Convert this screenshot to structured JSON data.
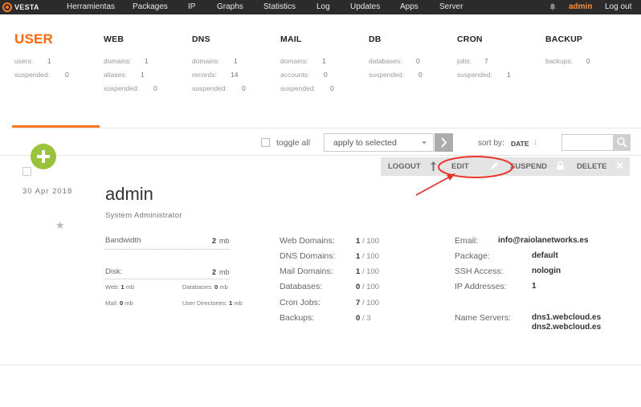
{
  "brand": {
    "logo_text": "VESTA"
  },
  "nav": {
    "items": [
      "Herramientas",
      "Packages",
      "IP",
      "Graphs",
      "Statistics",
      "Log",
      "Updates",
      "Apps",
      "Server"
    ],
    "user": "admin",
    "logout": "Log out"
  },
  "stats": {
    "user": {
      "title": "USER",
      "rows": [
        {
          "label": "users:",
          "value": "1"
        },
        {
          "label": "suspended:",
          "value": "0"
        }
      ]
    },
    "web": {
      "title": "WEB",
      "rows": [
        {
          "label": "domains:",
          "value": "1"
        },
        {
          "label": "aliases:",
          "value": "1"
        },
        {
          "label": "suspended:",
          "value": "0"
        }
      ]
    },
    "dns": {
      "title": "DNS",
      "rows": [
        {
          "label": "domains:",
          "value": "1"
        },
        {
          "label": "records:",
          "value": "14"
        },
        {
          "label": "suspended:",
          "value": "0"
        }
      ]
    },
    "mail": {
      "title": "MAIL",
      "rows": [
        {
          "label": "domains:",
          "value": "1"
        },
        {
          "label": "accounts:",
          "value": "0"
        },
        {
          "label": "suspended:",
          "value": "0"
        }
      ]
    },
    "db": {
      "title": "DB",
      "rows": [
        {
          "label": "databases:",
          "value": "0"
        },
        {
          "label": "suspended:",
          "value": "0"
        }
      ]
    },
    "cron": {
      "title": "CRON",
      "rows": [
        {
          "label": "jobs:",
          "value": "7"
        },
        {
          "label": "suspended:",
          "value": "1"
        }
      ]
    },
    "backup": {
      "title": "BACKUP",
      "rows": [
        {
          "label": "backups:",
          "value": "0"
        }
      ]
    }
  },
  "toolbar": {
    "toggle_all": "toggle all",
    "bulk_action": "apply to selected",
    "sort_by_label": "sort by:",
    "sort_by_value": "DATE",
    "sort_arrow": "↓"
  },
  "row": {
    "date": "30  Apr  2018",
    "username": "admin",
    "role": "System Administrator",
    "actions": {
      "logout": "LOGOUT",
      "edit": "EDIT",
      "suspend": "SUSPEND",
      "delete": "DELETE"
    },
    "bandwidth": {
      "label": "Bandwidth",
      "value": "2",
      "unit": "mb"
    },
    "disk": {
      "label": "Disk:",
      "value": "2",
      "unit": "mb"
    },
    "disk_breakdown": {
      "web_label": "Web:",
      "web_value": "1",
      "web_unit": "mb",
      "db_label": "Databases:",
      "db_value": "0",
      "db_unit": "mb",
      "mail_label": "Mail:",
      "mail_value": "0",
      "mail_unit": "mb",
      "udir_label": "User Directories:",
      "udir_value": "1",
      "udir_unit": "mb"
    },
    "quotas": [
      {
        "label": "Web Domains:",
        "used": "1",
        "limit": "/ 100"
      },
      {
        "label": "DNS Domains:",
        "used": "1",
        "limit": "/ 100"
      },
      {
        "label": "Mail Domains:",
        "used": "1",
        "limit": "/ 100"
      },
      {
        "label": "Databases:",
        "used": "0",
        "limit": "/ 100"
      },
      {
        "label": "Cron Jobs:",
        "used": "7",
        "limit": "/ 100"
      },
      {
        "label": "Backups:",
        "used": "0",
        "limit": "/ 3"
      }
    ],
    "info": {
      "email_label": "Email:",
      "email": "info@raiolanetworks.es",
      "package_label": "Package:",
      "package": "default",
      "ssh_label": "SSH Access:",
      "ssh": "nologin",
      "ip_label": "IP Addresses:",
      "ip": "1",
      "ns_label": "Name Servers:",
      "ns1": "dns1.webcloud.es",
      "ns2": "dns2.webcloud.es"
    }
  },
  "colors": {
    "accent": "#ff6701",
    "topbar": "#2b2b2b",
    "add": "#9ac23b",
    "annotation": "#e8352b"
  }
}
